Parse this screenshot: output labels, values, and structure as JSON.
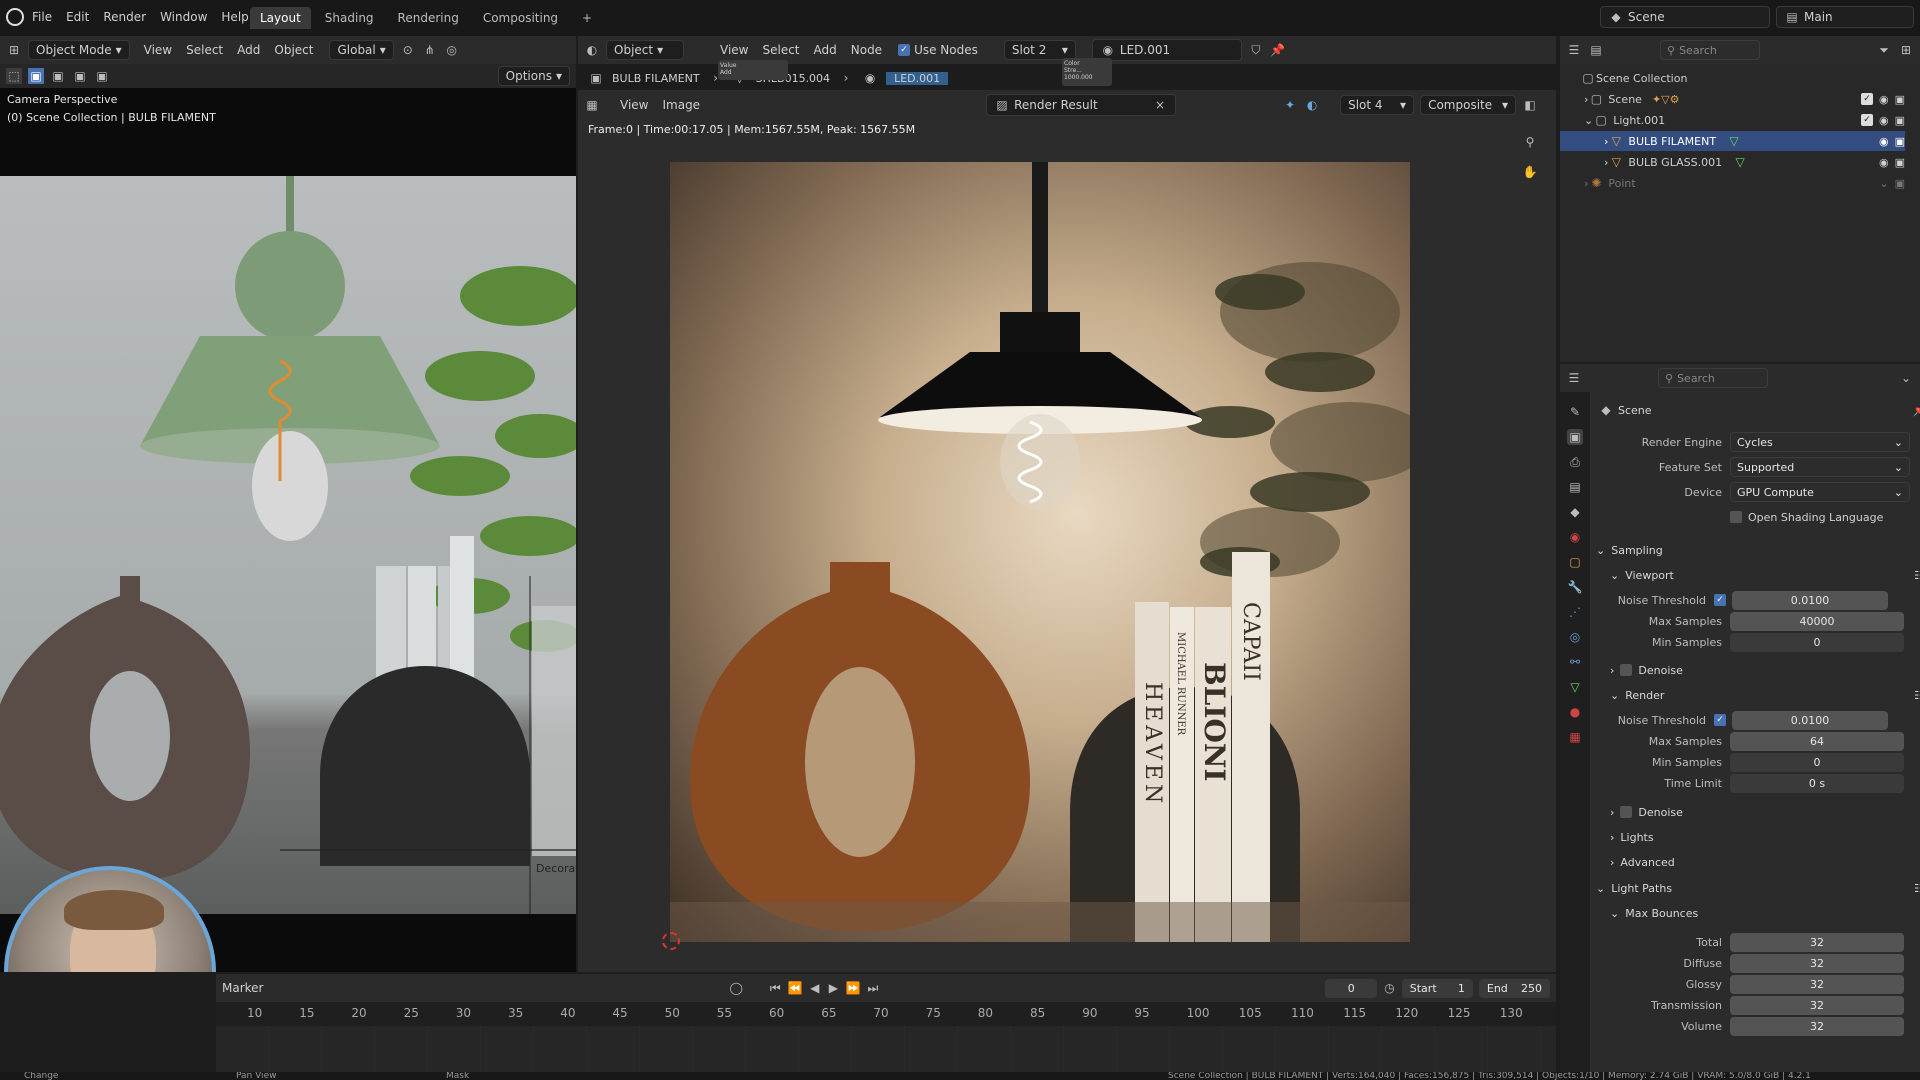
{
  "topbar": {
    "menus": [
      "File",
      "Edit",
      "Render",
      "Window",
      "Help"
    ],
    "workspaces": [
      "Layout",
      "Shading",
      "Rendering",
      "Compositing"
    ],
    "active_workspace": "Layout",
    "scene": "Scene",
    "view_layer": "Main"
  },
  "viewport": {
    "mode": "Object Mode",
    "menus": [
      "View",
      "Select",
      "Add",
      "Object"
    ],
    "transform": "Global",
    "options": "Options",
    "perspective": "Camera Perspective",
    "collection_info": "(0) Scene Collection | BULB FILAMENT",
    "decor_label": "Decorat"
  },
  "node_editor": {
    "type": "Object",
    "menus": [
      "View",
      "Select",
      "Add",
      "Node"
    ],
    "use_nodes": "Use Nodes",
    "slot": "Slot 2",
    "material": "LED.001",
    "breadcrumbs": [
      "BULB FILAMENT",
      "SHLB015.004",
      "LED.001"
    ],
    "node_a_title": "Value",
    "node_a_sub": "Add",
    "node_b_title": "Color",
    "node_b_sub": "Stre... 1000.000"
  },
  "image_editor": {
    "menus": [
      "View",
      "Image"
    ],
    "image": "Render Result",
    "slot": "Slot 4",
    "layer": "Composite",
    "stats": "Frame:0 | Time:00:17.05 | Mem:1567.55M, Peak: 1567.55M",
    "books": [
      "HEAVEN",
      "MICHAEL RUNNER",
      "BLIONI",
      "CAPAII"
    ]
  },
  "outliner": {
    "search": "Search",
    "root": "Scene Collection",
    "items": [
      {
        "name": "Scene",
        "level": 1
      },
      {
        "name": "Light.001",
        "level": 1
      },
      {
        "name": "BULB FILAMENT",
        "level": 2,
        "selected": true
      },
      {
        "name": "BULB GLASS.001",
        "level": 2
      },
      {
        "name": "Point",
        "level": 1,
        "dim": true
      }
    ]
  },
  "properties": {
    "search": "Search",
    "context": "Scene",
    "render_engine_label": "Render Engine",
    "render_engine": "Cycles",
    "feature_set_label": "Feature Set",
    "feature_set": "Supported",
    "device_label": "Device",
    "device": "GPU Compute",
    "osl": "Open Shading Language",
    "sampling": "Sampling",
    "viewport": "Viewport",
    "noise_threshold": "Noise Threshold",
    "vp_noise": "0.0100",
    "max_samples": "Max Samples",
    "vp_max": "40000",
    "min_samples": "Min Samples",
    "vp_min": "0",
    "denoise": "Denoise",
    "render": "Render",
    "r_noise": "0.0100",
    "r_max": "64",
    "r_min": "0",
    "time_limit": "Time Limit",
    "r_time": "0 s",
    "lights": "Lights",
    "advanced": "Advanced",
    "light_paths": "Light Paths",
    "max_bounces": "Max Bounces",
    "total": "Total",
    "total_v": "32",
    "diffuse": "Diffuse",
    "diffuse_v": "32",
    "glossy": "Glossy",
    "glossy_v": "32",
    "transmission": "Transmission",
    "transmission_v": "32",
    "volume": "Volume",
    "volume_v": "32"
  },
  "timeline": {
    "marker": "Marker",
    "frame": "0",
    "start_label": "Start",
    "start": "1",
    "end_label": "End",
    "end": "250",
    "ticks": [
      "10",
      "15",
      "20",
      "25",
      "30",
      "35",
      "40",
      "45",
      "50",
      "55",
      "60",
      "65",
      "70",
      "75",
      "80",
      "85",
      "90",
      "95",
      "100",
      "105",
      "110",
      "115",
      "120",
      "125",
      "130"
    ]
  },
  "statusbar": {
    "left1": "Change",
    "left2": "Pan View",
    "left3": "Mask",
    "right": "Scene Collection | BULB FILAMENT | Verts:164,040 | Faces:156,875 | Tris:309,514 | Objects:1/10 | Memory: 2.74 GiB | VRAM: 5.0/8.0 GiB | 4.2.1"
  }
}
